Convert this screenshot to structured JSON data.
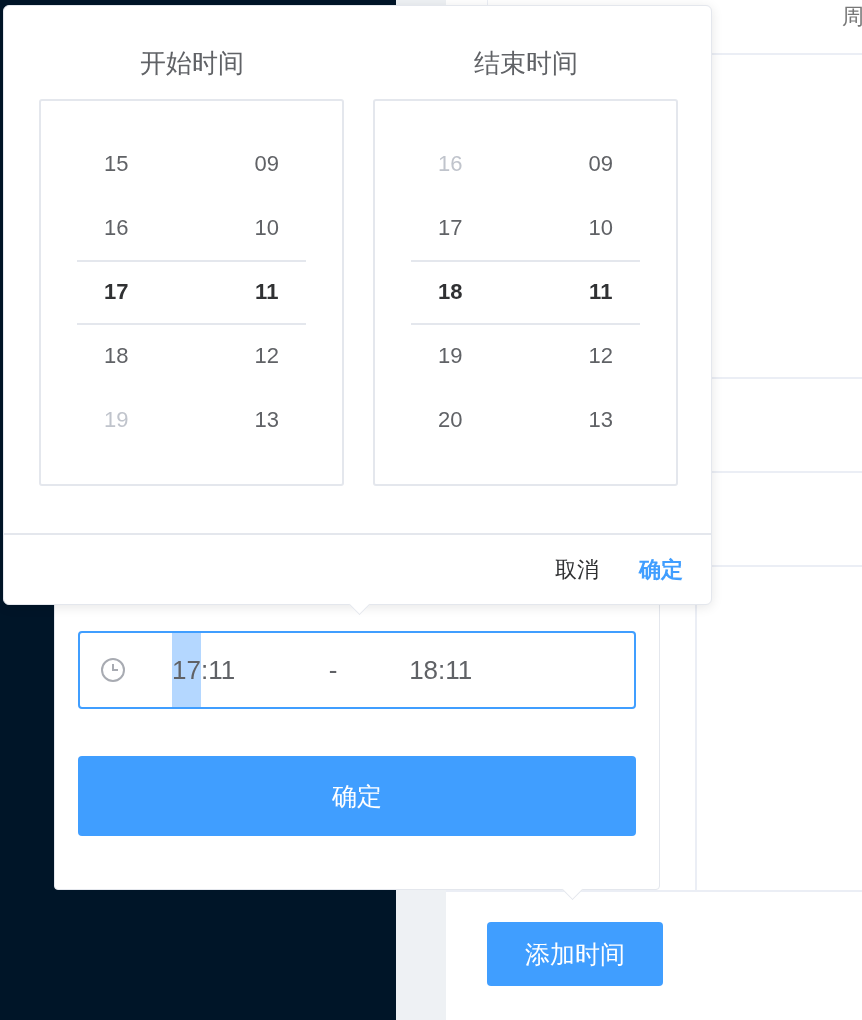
{
  "page": {
    "table_header": "周",
    "add_button": "添加时间"
  },
  "time_range_field": {
    "start": [
      {
        "text": "17",
        "selected": true
      },
      {
        "text": ":11",
        "selected": false
      }
    ],
    "separator": "-",
    "end": "18:11",
    "confirm_button": "确定"
  },
  "time_picker": {
    "panels": [
      {
        "title": "开始时间",
        "columns": [
          {
            "items": [
              {
                "text": "15",
                "disabled": false,
                "selected": false
              },
              {
                "text": "16",
                "disabled": false,
                "selected": false
              },
              {
                "text": "17",
                "disabled": false,
                "selected": true
              },
              {
                "text": "18",
                "disabled": false,
                "selected": false
              },
              {
                "text": "19",
                "disabled": true,
                "selected": false
              }
            ]
          },
          {
            "items": [
              {
                "text": "09",
                "disabled": false,
                "selected": false
              },
              {
                "text": "10",
                "disabled": false,
                "selected": false
              },
              {
                "text": "11",
                "disabled": false,
                "selected": true
              },
              {
                "text": "12",
                "disabled": false,
                "selected": false
              },
              {
                "text": "13",
                "disabled": false,
                "selected": false
              }
            ]
          }
        ]
      },
      {
        "title": "结束时间",
        "columns": [
          {
            "items": [
              {
                "text": "16",
                "disabled": true,
                "selected": false
              },
              {
                "text": "17",
                "disabled": false,
                "selected": false
              },
              {
                "text": "18",
                "disabled": false,
                "selected": true
              },
              {
                "text": "19",
                "disabled": false,
                "selected": false
              },
              {
                "text": "20",
                "disabled": false,
                "selected": false
              }
            ]
          },
          {
            "items": [
              {
                "text": "09",
                "disabled": false,
                "selected": false
              },
              {
                "text": "10",
                "disabled": false,
                "selected": false
              },
              {
                "text": "11",
                "disabled": false,
                "selected": true
              },
              {
                "text": "12",
                "disabled": false,
                "selected": false
              },
              {
                "text": "13",
                "disabled": false,
                "selected": false
              }
            ]
          }
        ]
      }
    ],
    "cancel": "取消",
    "ok": "确定"
  }
}
